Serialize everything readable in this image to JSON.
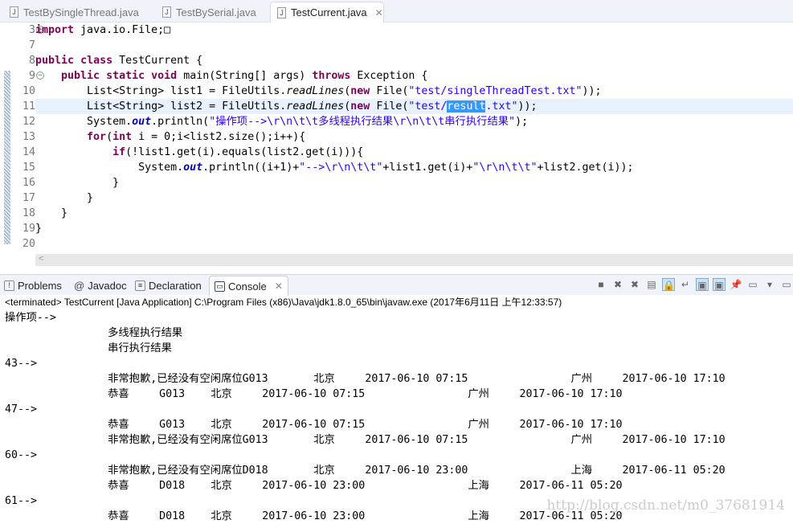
{
  "editor_tabs": [
    {
      "label": "TestBySingleThread.java",
      "active": false
    },
    {
      "label": "TestBySerial.java",
      "active": false
    },
    {
      "label": "TestCurrent.java",
      "active": true
    }
  ],
  "code": {
    "line_numbers": [
      "3",
      "7",
      "8",
      "9",
      "10",
      "11",
      "12",
      "13",
      "14",
      "15",
      "16",
      "17",
      "18",
      "19",
      "20"
    ],
    "lines": [
      [
        [
          "import",
          "kw"
        ],
        [
          " java.io.File;",
          ""
        ],
        [
          "□",
          ""
        ]
      ],
      [],
      [
        [
          "public",
          "kw"
        ],
        [
          " ",
          ""
        ],
        [
          "class",
          "kw"
        ],
        [
          " TestCurrent {",
          ""
        ]
      ],
      [
        [
          "    ",
          ""
        ],
        [
          "public",
          "kw"
        ],
        [
          " ",
          ""
        ],
        [
          "static",
          "kw"
        ],
        [
          " ",
          ""
        ],
        [
          "void",
          "kw"
        ],
        [
          " main(String[] args) ",
          ""
        ],
        [
          "throws",
          "kw"
        ],
        [
          " Exception {",
          ""
        ]
      ],
      [
        [
          "        List<String> list1 = FileUtils.",
          ""
        ],
        [
          "readLines",
          "it"
        ],
        [
          "(",
          ""
        ],
        [
          "new",
          "kw"
        ],
        [
          " File(",
          ""
        ],
        [
          "\"test/singleThreadTest.txt\"",
          "str"
        ],
        [
          "));",
          ""
        ]
      ],
      [
        [
          "        List<String> list2 = FileUtils.",
          ""
        ],
        [
          "readLines",
          "it"
        ],
        [
          "(",
          ""
        ],
        [
          "new",
          "kw"
        ],
        [
          " File(",
          ""
        ],
        [
          "\"test/",
          "str"
        ],
        [
          "result",
          "sel"
        ],
        [
          ".txt\"",
          "str"
        ],
        [
          "));",
          ""
        ]
      ],
      [
        [
          "        System.",
          ""
        ],
        [
          "out",
          "fld"
        ],
        [
          ".println(",
          ""
        ],
        [
          "\"操作项-->\\r\\n\\t\\t多线程执行结果\\r\\n\\t\\t串行执行结果\"",
          "str"
        ],
        [
          ");",
          ""
        ]
      ],
      [
        [
          "        ",
          ""
        ],
        [
          "for",
          "kw"
        ],
        [
          "(",
          ""
        ],
        [
          "int",
          "kw"
        ],
        [
          " i = 0;i<list2.size();i++){",
          ""
        ]
      ],
      [
        [
          "            ",
          ""
        ],
        [
          "if",
          "kw"
        ],
        [
          "(!list1.get(i).equals(list2.get(i))){",
          ""
        ]
      ],
      [
        [
          "                System.",
          ""
        ],
        [
          "out",
          "fld"
        ],
        [
          ".println((i+1)+",
          ""
        ],
        [
          "\"-->\\r\\n\\t\\t\"",
          "str"
        ],
        [
          "+list1.get(i)+",
          ""
        ],
        [
          "\"\\r\\n\\t\\t\"",
          "str"
        ],
        [
          "+list2.get(i));",
          ""
        ]
      ],
      [
        [
          "            }",
          ""
        ]
      ],
      [
        [
          "        }",
          ""
        ]
      ],
      [
        [
          "    }",
          ""
        ]
      ],
      [
        [
          "}",
          ""
        ]
      ],
      []
    ]
  },
  "panel_tabs": [
    {
      "label": "Problems",
      "icon": "problems-icon"
    },
    {
      "label": "Javadoc",
      "icon": "at-icon"
    },
    {
      "label": "Declaration",
      "icon": "declaration-icon"
    },
    {
      "label": "Console",
      "icon": "console-icon",
      "active": true
    }
  ],
  "console": {
    "status": "<terminated> TestCurrent [Java Application] C:\\Program Files (x86)\\Java\\jdk1.8.0_65\\bin\\javaw.exe (2017年6月11日 上午12:33:57)",
    "lines": [
      "操作项-->",
      "\t\t多线程执行结果",
      "\t\t串行执行结果",
      "43-->",
      "\t\t非常抱歉,已经没有空闲席位G013\t北京\t2017-06-10 07:15\t\t广州\t2017-06-10 17:10",
      "\t\t恭喜\tG013\t北京\t2017-06-10 07:15\t\t广州\t2017-06-10 17:10",
      "47-->",
      "\t\t恭喜\tG013\t北京\t2017-06-10 07:15\t\t广州\t2017-06-10 17:10",
      "\t\t非常抱歉,已经没有空闲席位G013\t北京\t2017-06-10 07:15\t\t广州\t2017-06-10 17:10",
      "60-->",
      "\t\t非常抱歉,已经没有空闲席位D018\t北京\t2017-06-10 23:00\t\t上海\t2017-06-11 05:20",
      "\t\t恭喜\tD018\t北京\t2017-06-10 23:00\t\t上海\t2017-06-11 05:20",
      "61-->",
      "\t\t恭喜\tD018\t北京\t2017-06-10 23:00\t\t上海\t2017-06-11 05:20"
    ]
  },
  "watermark": "http://blog.csdn.net/m0_37681914"
}
